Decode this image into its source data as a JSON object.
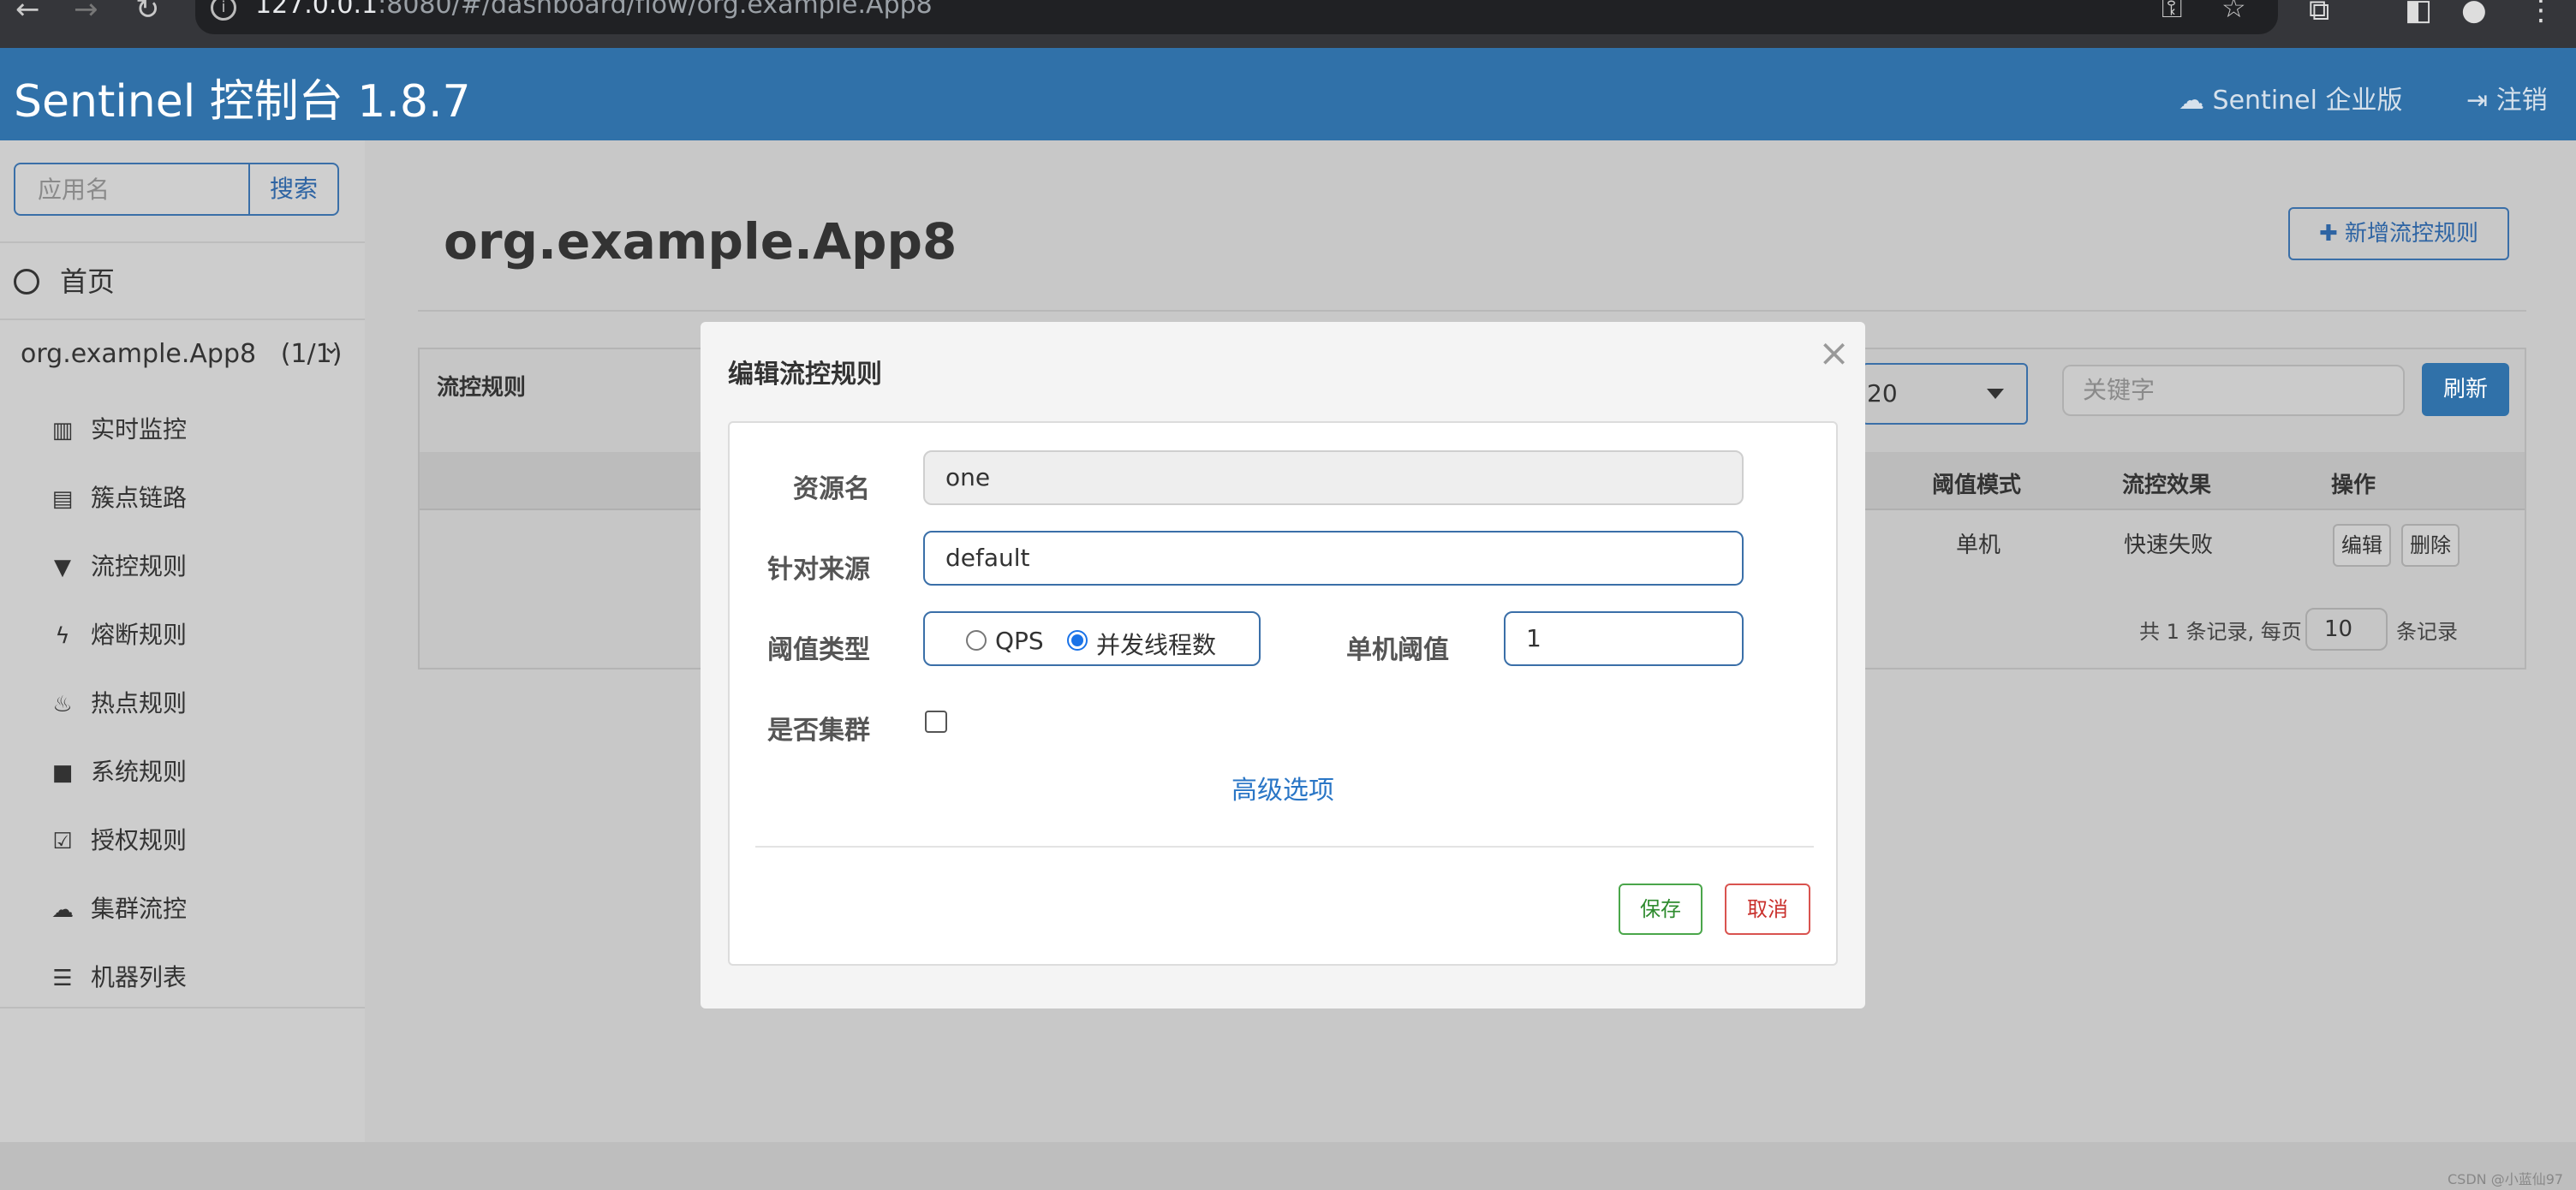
{
  "browser": {
    "url_host": "127.0.0.1",
    "url_rest": ":8080/#/dashboard/flow/org.example.App8"
  },
  "header": {
    "brand": "Sentinel 控制台 1.8.7",
    "enterprise": "Sentinel 企业版",
    "logout": "注销"
  },
  "sidebar": {
    "search_placeholder": "应用名",
    "search_button": "搜索",
    "home": "首页",
    "app_name": "org.example.App8",
    "app_count": "(1/1)",
    "items": [
      {
        "label": "实时监控",
        "icon": "bar-chart-icon"
      },
      {
        "label": "簇点链路",
        "icon": "list-alt-icon"
      },
      {
        "label": "流控规则",
        "icon": "filter-icon"
      },
      {
        "label": "熔断规则",
        "icon": "bolt-icon"
      },
      {
        "label": "热点规则",
        "icon": "fire-icon"
      },
      {
        "label": "系统规则",
        "icon": "lock-icon"
      },
      {
        "label": "授权规则",
        "icon": "check-square-icon"
      },
      {
        "label": "集群流控",
        "icon": "cloud-icon"
      },
      {
        "label": "机器列表",
        "icon": "th-list-icon"
      }
    ]
  },
  "main": {
    "title": "org.example.App8",
    "add_button": "新增流控规则",
    "panel_title": "流控规则",
    "page_size_select": "20",
    "keyword_placeholder": "关键字",
    "refresh_button": "刷新",
    "columns": [
      "阈值模式",
      "流控效果",
      "操作"
    ],
    "row": {
      "mode": "单机",
      "effect": "快速失败"
    },
    "edit_button": "编辑",
    "delete_button": "删除",
    "pager_prefix": "共 1 条记录, 每页",
    "pager_size": "10",
    "pager_suffix": "条记录"
  },
  "modal": {
    "title": "编辑流控规则",
    "resource_label": "资源名",
    "resource_value": "one",
    "origin_label": "针对来源",
    "origin_value": "default",
    "threshold_type_label": "阈值类型",
    "option_qps": "QPS",
    "option_threads": "并发线程数",
    "selected_option": "并发线程数",
    "threshold_label": "单机阈值",
    "threshold_value": "1",
    "cluster_label": "是否集群",
    "cluster_checked": false,
    "advanced_link": "高级选项",
    "save_button": "保存",
    "cancel_button": "取消"
  },
  "watermark": "CSDN @小蓝仙97",
  "colors": {
    "header_bg": "#3071a9",
    "primary": "#3071a9",
    "save": "#4aa64a",
    "cancel": "#d9534f",
    "link": "#2a76c6"
  }
}
